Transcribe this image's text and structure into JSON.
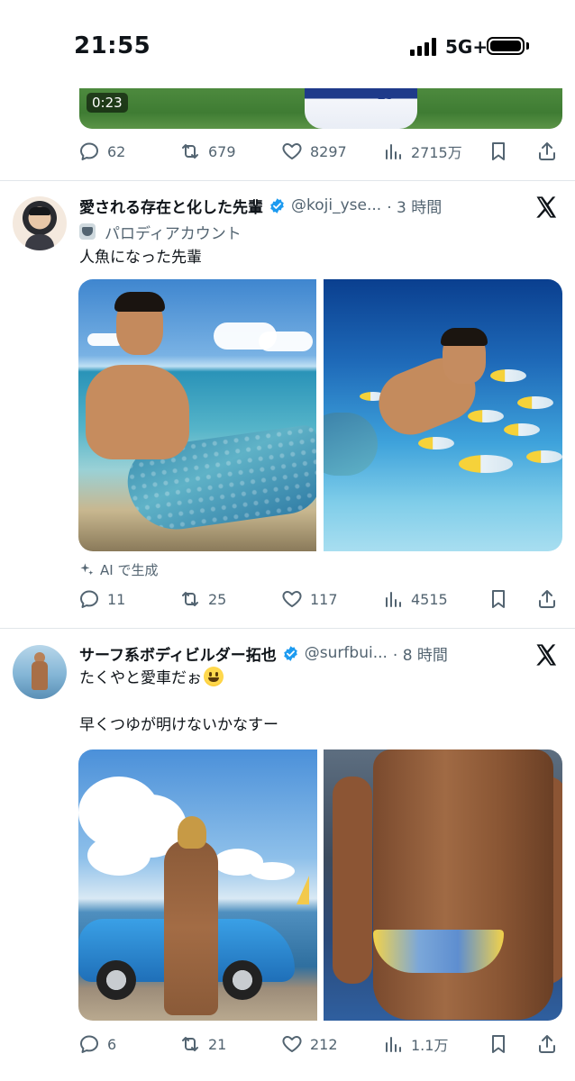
{
  "status_bar": {
    "time": "21:55",
    "network": "5G+"
  },
  "previous_tweet": {
    "video_time": "0:23",
    "reply_count": "62",
    "repost_count": "679",
    "like_count": "8297",
    "view_count": "2715万"
  },
  "tweets": [
    {
      "display_name": "愛される存在と化した先輩",
      "handle": "@koji_yse...",
      "time": "· 3 時間",
      "parody_label": "パロディアカウント",
      "text": "人魚になった先輩",
      "ai_label": "AI で生成",
      "reply_count": "11",
      "repost_count": "25",
      "like_count": "117",
      "view_count": "4515"
    },
    {
      "display_name": "サーフ系ボディビルダー拓也",
      "handle": "@surfbui...",
      "time": "· 8 時間",
      "text_line1": "たくやと愛車だぉ",
      "text_line2": "早くつゆが明けないかなすー",
      "reply_count": "6",
      "repost_count": "21",
      "like_count": "212",
      "view_count": "1.1万"
    }
  ],
  "icons": {
    "reply": "reply-icon",
    "repost": "repost-icon",
    "like": "heart-icon",
    "views": "views-icon",
    "bookmark": "bookmark-icon",
    "share": "share-icon",
    "verified": "verified-badge-icon",
    "x": "x-logo-icon",
    "ai": "sparkle-icon"
  },
  "colors": {
    "text": "#0f1419",
    "secondary": "#536471",
    "verified": "#1d9bf0",
    "divider": "#e1e6ea"
  }
}
